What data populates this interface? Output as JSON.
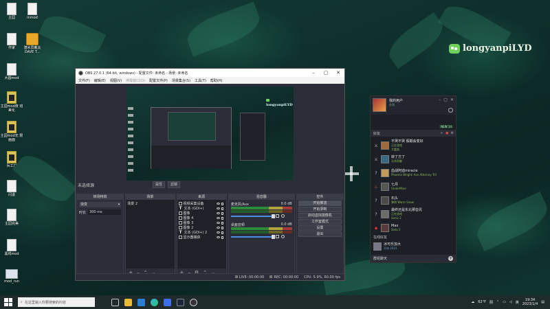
{
  "desktop": {
    "watermark": "longyanpiLYD",
    "icons": [
      {
        "label": "主园",
        "kind": "file"
      },
      {
        "label": "inmod",
        "kind": "file"
      },
      {
        "label": "作家",
        "kind": "file"
      },
      {
        "label": "潜水员戴夫 DAVE T...",
        "kind": "game"
      },
      {
        "label": "大圆mod",
        "kind": "file"
      },
      {
        "label": "主园mod夜 班美化",
        "kind": "dark"
      },
      {
        "label": "主园mod无 限画面",
        "kind": "dark"
      },
      {
        "label": "兵工厂",
        "kind": "dark"
      },
      {
        "label": "闪退",
        "kind": "file"
      },
      {
        "label": "主园完美",
        "kind": "file"
      },
      {
        "label": "黑线mod",
        "kind": "file"
      },
      {
        "label": "mod_run",
        "kind": "img"
      }
    ]
  },
  "obs": {
    "title": "OBS 27.0.1 (64-bit, windows) - 配置文件: 未命名 - 场景: 未命名",
    "menu": [
      "文件(F)",
      "编辑(E)",
      "视图(V)",
      "停靠窗口(D)",
      "配置文件(P)",
      "场景集合(S)",
      "工具(T)",
      "帮助(H)"
    ],
    "menu_dim": [
      false,
      false,
      false,
      true,
      false,
      false,
      false,
      false
    ],
    "preview_watermark": "longyanpiLYD",
    "scene_bar_label": "未选择源",
    "scene_toolbar": [
      "属性",
      "滤镜"
    ],
    "docks": {
      "transitions": {
        "title": "转场特效",
        "selected": "渐变",
        "duration_label": "时长",
        "duration_value": "300 ms"
      },
      "scenes": {
        "title": "场景",
        "items": [
          "场景 2"
        ]
      },
      "sources": {
        "title": "来源",
        "items": [
          {
            "label": "视频采集设备",
            "type": "img"
          },
          {
            "label": "文本 (GDI+)",
            "type": "text"
          },
          {
            "label": "图像",
            "type": "img"
          },
          {
            "label": "图像 4",
            "type": "img"
          },
          {
            "label": "图像 3",
            "type": "img"
          },
          {
            "label": "图像 2",
            "type": "img"
          },
          {
            "label": "文本 (GDI+) 2",
            "type": "text"
          },
          {
            "label": "显示器捕获",
            "type": "img"
          }
        ]
      },
      "mixer": {
        "title": "混音器",
        "channels": [
          {
            "name": "麦克风/Aux",
            "db": "0.0 dB"
          },
          {
            "name": "桌面音频",
            "db": "0.0 dB"
          }
        ]
      },
      "controls": {
        "title": "控件",
        "buttons": [
          "开始推流",
          "开始录制",
          "启动虚拟摄像机",
          "工作室模式",
          "设置",
          "退出"
        ]
      }
    },
    "status": {
      "live_label": "LIVE:",
      "live_time": "00:00:00",
      "rec_label": "REC:",
      "rec_time": "00:00:00",
      "cpu": "CPU: 5.9%, 60.00 fps"
    }
  },
  "steam": {
    "username": "我的用户",
    "status": "在线",
    "news_badge": "NEW 14",
    "search_placeholder": "好友",
    "friends": [
      {
        "name": "不哭不哭 假期会变好",
        "game": "正在游戏",
        "game2": "大富翁",
        "icon": "sword"
      },
      {
        "name": "转了方了",
        "game": "天命奇御",
        "icon": "sword"
      },
      {
        "name": "血战阿迪miracle",
        "game": "Phoenix Wright: Ace Attorney Tril",
        "icon": "question"
      },
      {
        "name": "七月",
        "game": "UnderMine",
        "icon": "fire"
      },
      {
        "name": "石头",
        "game": "黎明 Warm Snow",
        "icon": "question"
      },
      {
        "name": "最终还是东北那旮旯",
        "game": "正在游戏",
        "game2": "Sonic 2",
        "icon": "question"
      },
      {
        "name": "Max",
        "game": "Dota 2",
        "icon": "dota"
      }
    ],
    "offline_heading": "在线好友",
    "offline_friend": {
      "name": "冰可乐加大",
      "game": "开始 2023"
    },
    "footer_label": "群组聊天"
  },
  "taskbar": {
    "search_placeholder": "在这里输入你要搜索的内容",
    "weather": "62°F",
    "weather_desc": "阴",
    "ime": "英",
    "time": "19:34",
    "date": "2023/1/4"
  }
}
